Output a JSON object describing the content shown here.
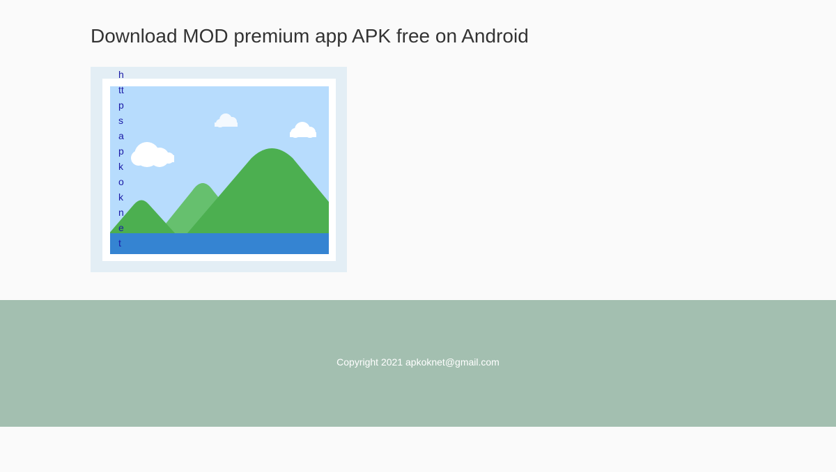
{
  "page": {
    "title": "Download MOD premium app APK free on Android"
  },
  "image": {
    "icon": "image-placeholder-icon",
    "link_text": "https://apkok.net"
  },
  "footer": {
    "copyright": "Copyright 2021",
    "email": "apkoknet@gmail.com"
  },
  "colors": {
    "footer_bg": "#a3bfb0",
    "sky": "#b7dcfd",
    "water": "#3584d2",
    "mountain_dark": "#4caf50",
    "mountain_light": "#66c06e"
  }
}
